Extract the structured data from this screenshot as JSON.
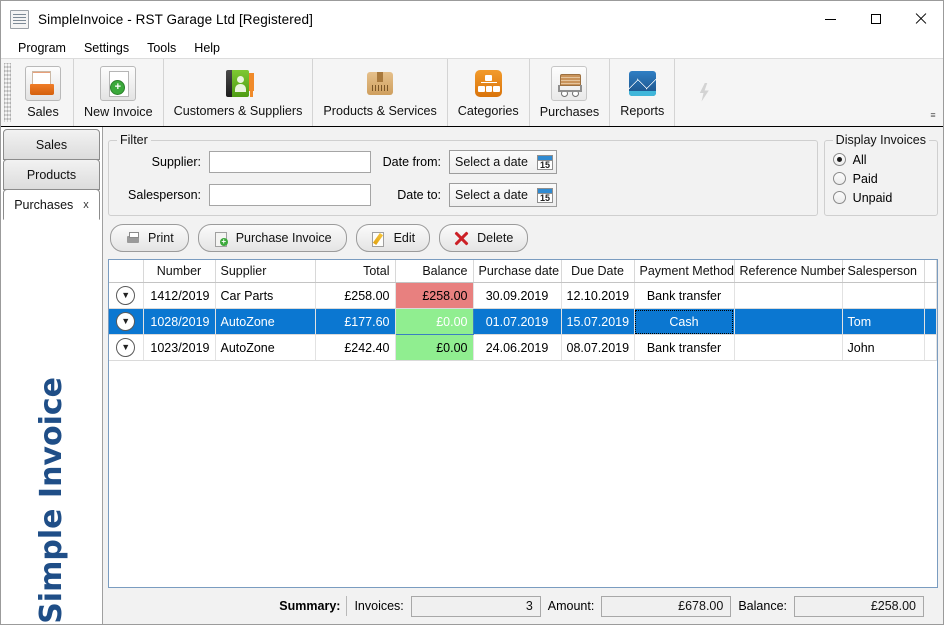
{
  "window": {
    "title": "SimpleInvoice - RST Garage Ltd   [Registered]",
    "minimize": "minimize",
    "maximize": "maximize",
    "close": "close"
  },
  "menu": [
    "Program",
    "Settings",
    "Tools",
    "Help"
  ],
  "toolbar": {
    "items": [
      {
        "label": "Sales",
        "icon": "sales-folder-icon"
      },
      {
        "label": "New Invoice",
        "icon": "new-document-icon"
      },
      {
        "label": "Customers & Suppliers",
        "icon": "address-book-icon"
      },
      {
        "label": "Products & Services",
        "icon": "package-box-icon"
      },
      {
        "label": "Categories",
        "icon": "category-tree-icon"
      },
      {
        "label": "Purchases",
        "icon": "shopping-cart-icon"
      },
      {
        "label": "Reports",
        "icon": "chart-report-icon"
      }
    ],
    "quick_icon": "lightning-bolt-icon",
    "overflow": "≡"
  },
  "rail": {
    "tabs": [
      {
        "label": "Sales",
        "active": false,
        "closable": false
      },
      {
        "label": "Products",
        "active": false,
        "closable": false
      },
      {
        "label": "Purchases",
        "active": true,
        "closable": true,
        "close": "x"
      }
    ],
    "brand": "Simple Invoice",
    "brand_color": "#1f4e87"
  },
  "filter": {
    "legend": "Filter",
    "supplier_label": "Supplier:",
    "supplier_value": "",
    "supplier_placeholder": "",
    "salesperson_label": "Salesperson:",
    "salesperson_value": "",
    "salesperson_placeholder": "",
    "date_from_label": "Date from:",
    "date_from_value": "Select a date",
    "date_to_label": "Date to:",
    "date_to_value": "Select a date",
    "calendar_day": "15"
  },
  "display_invoices": {
    "legend": "Display Invoices",
    "options": [
      {
        "label": "All",
        "selected": true
      },
      {
        "label": "Paid",
        "selected": false
      },
      {
        "label": "Unpaid",
        "selected": false
      }
    ]
  },
  "actions": [
    {
      "label": "Print",
      "icon": "printer-icon"
    },
    {
      "label": "Purchase Invoice",
      "icon": "new-invoice-icon"
    },
    {
      "label": "Edit",
      "icon": "edit-pencil-icon"
    },
    {
      "label": "Delete",
      "icon": "delete-x-icon"
    }
  ],
  "grid": {
    "columns": [
      "",
      "Number",
      "Supplier",
      "Total",
      "Balance",
      "Purchase date",
      "Due Date",
      "Payment Method",
      "Reference Number",
      "Salesperson"
    ],
    "rows": [
      {
        "expand": "chevron-down",
        "number": "1412/2019",
        "supplier": "Car Parts",
        "total": "£258.00",
        "balance": "£258.00",
        "balance_state": "red",
        "purchase_date": "30.09.2019",
        "due_date": "12.10.2019",
        "payment_method": "Bank transfer",
        "reference_number": "",
        "salesperson": "",
        "selected": false
      },
      {
        "expand": "chevron-down",
        "number": "1028/2019",
        "supplier": "AutoZone",
        "total": "£177.60",
        "balance": "£0.00",
        "balance_state": "green",
        "purchase_date": "01.07.2019",
        "due_date": "15.07.2019",
        "payment_method": "Cash",
        "reference_number": "",
        "salesperson": "Tom",
        "selected": true,
        "focused_cell": "payment_method"
      },
      {
        "expand": "chevron-down",
        "number": "1023/2019",
        "supplier": "AutoZone",
        "total": "£242.40",
        "balance": "£0.00",
        "balance_state": "green",
        "purchase_date": "24.06.2019",
        "due_date": "08.07.2019",
        "payment_method": "Bank transfer",
        "reference_number": "",
        "salesperson": "John",
        "selected": false
      }
    ],
    "colors": {
      "selection": "#0b77d1",
      "balance_red": "#e8807f",
      "balance_green": "#90ee90"
    }
  },
  "summary": {
    "title": "Summary:",
    "invoices_label": "Invoices:",
    "invoices_value": "3",
    "amount_label": "Amount:",
    "amount_value": "£678.00",
    "balance_label": "Balance:",
    "balance_value": "£258.00"
  }
}
